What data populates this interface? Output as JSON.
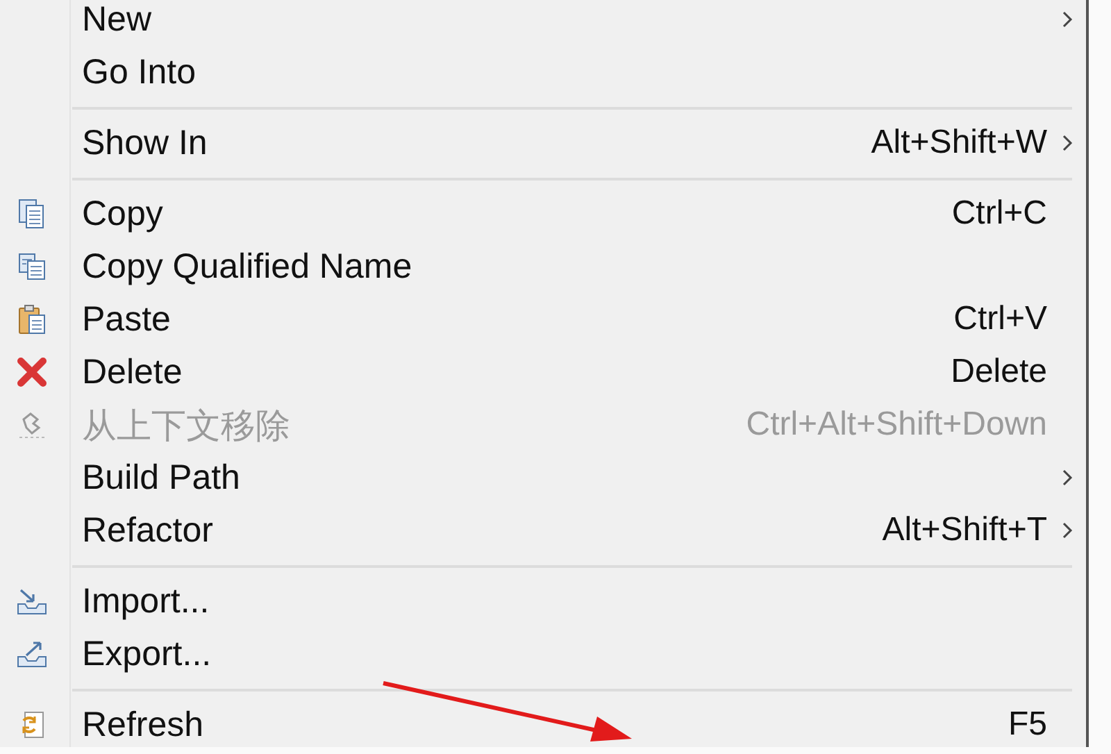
{
  "menu": {
    "groups": [
      {
        "items": [
          {
            "label": "New",
            "submenu": true,
            "disabled": false,
            "kind": "plain"
          },
          {
            "label": "Go Into",
            "submenu": false,
            "disabled": false,
            "kind": "plain"
          }
        ]
      },
      {
        "items": [
          {
            "label": "Show In",
            "shortcut": "Alt+Shift+W",
            "submenu": true,
            "disabled": false,
            "kind": "plain"
          }
        ]
      },
      {
        "items": [
          {
            "label": "Copy",
            "shortcut": "Ctrl+C",
            "submenu": false,
            "disabled": false,
            "kind": "copy"
          },
          {
            "label": "Copy Qualified Name",
            "submenu": false,
            "disabled": false,
            "kind": "copy-qualified"
          },
          {
            "label": "Paste",
            "shortcut": "Ctrl+V",
            "submenu": false,
            "disabled": false,
            "kind": "paste"
          },
          {
            "label": "Delete",
            "shortcut": "Delete",
            "submenu": false,
            "disabled": false,
            "kind": "delete"
          },
          {
            "label": "从上下文移除",
            "shortcut": "Ctrl+Alt+Shift+Down",
            "submenu": false,
            "disabled": true,
            "kind": "remove"
          },
          {
            "label": "Build Path",
            "submenu": true,
            "disabled": false,
            "kind": "plain"
          },
          {
            "label": "Refactor",
            "shortcut": "Alt+Shift+T",
            "submenu": true,
            "disabled": false,
            "kind": "plain"
          }
        ]
      },
      {
        "items": [
          {
            "label": "Import...",
            "submenu": false,
            "disabled": false,
            "kind": "import"
          },
          {
            "label": "Export...",
            "submenu": false,
            "disabled": false,
            "kind": "export"
          }
        ]
      },
      {
        "items": [
          {
            "label": "Refresh",
            "shortcut": "F5",
            "submenu": false,
            "disabled": false,
            "kind": "refresh"
          }
        ]
      }
    ]
  }
}
